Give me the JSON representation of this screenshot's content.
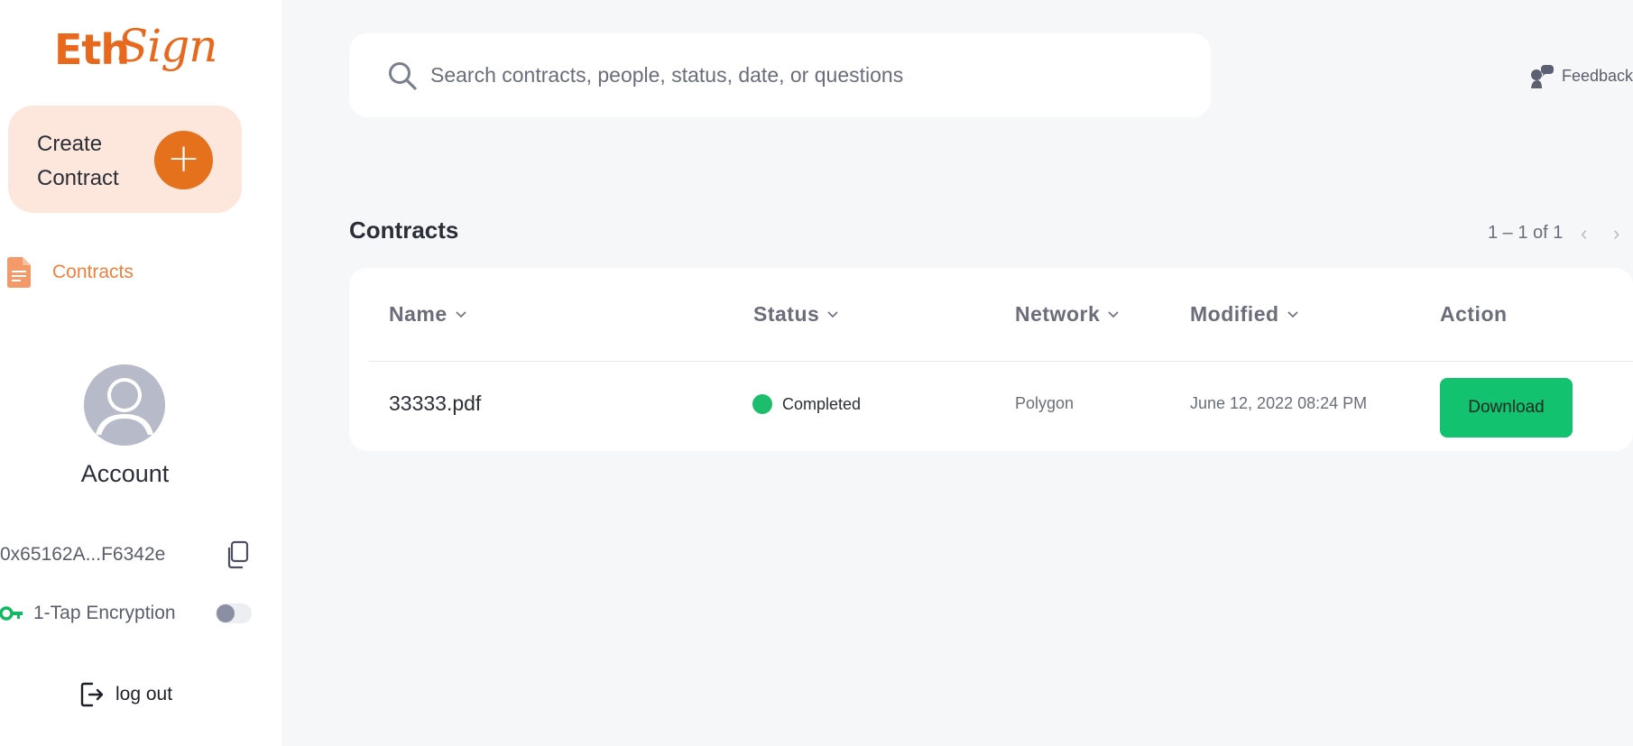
{
  "colors": {
    "brand": "#e8691e",
    "create_card_bg": "#fde6dc",
    "create_button": "#e6711d",
    "nav_active": "#f0803d",
    "status_completed": "#1cbe6d",
    "download_button": "#12c26e",
    "page_bg": "#f6f7f9"
  },
  "logo": {
    "part1": "Eth",
    "part2": "Sign"
  },
  "sidebar": {
    "create_label": "Create Contract",
    "create_icon": "plus-icon",
    "nav": [
      {
        "label": "Contracts",
        "icon": "document-icon",
        "active": true
      }
    ],
    "account": {
      "avatar_icon": "user-avatar-icon",
      "title": "Account",
      "address": "0x65162A...F6342e",
      "copy_icon": "copy-icon",
      "encryption_label": "1-Tap Encryption",
      "encryption_icon": "key-icon",
      "encryption_enabled": false
    },
    "logout_label": "log out",
    "logout_icon": "logout-icon"
  },
  "search": {
    "placeholder": "Search contracts, people, status, date, or questions",
    "icon": "search-icon"
  },
  "feedback": {
    "label": "Feedback",
    "icon": "chat-bubbles-icon"
  },
  "contracts": {
    "title": "Contracts",
    "pagination": "1 – 1 of 1",
    "prev_icon": "chevron-left-icon",
    "next_icon": "chevron-right-icon",
    "columns": [
      {
        "label": "Name",
        "sortable": true
      },
      {
        "label": "Status",
        "sortable": true
      },
      {
        "label": "Network",
        "sortable": true
      },
      {
        "label": "Modified",
        "sortable": true
      },
      {
        "label": "Action",
        "sortable": false
      }
    ],
    "rows": [
      {
        "name": "33333.pdf",
        "status": "Completed",
        "network": "Polygon",
        "modified": "June 12, 2022 08:24 PM",
        "action": "Download"
      }
    ]
  }
}
